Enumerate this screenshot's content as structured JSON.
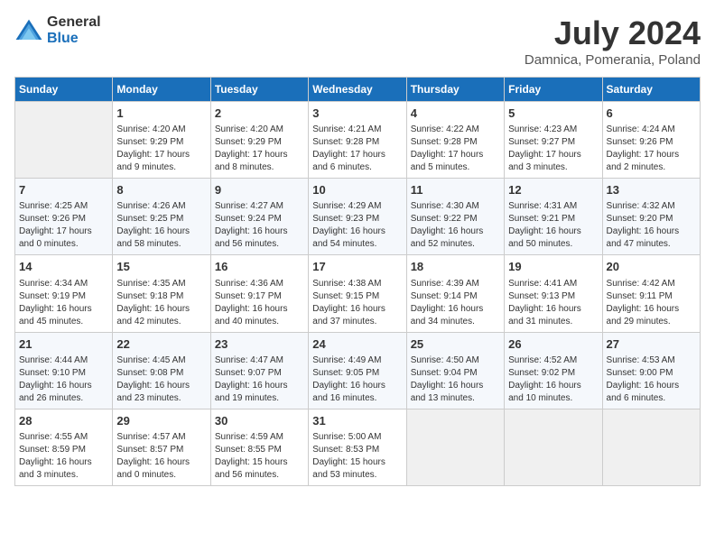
{
  "header": {
    "logo_line1": "General",
    "logo_line2": "Blue",
    "month_year": "July 2024",
    "location": "Damnica, Pomerania, Poland"
  },
  "weekdays": [
    "Sunday",
    "Monday",
    "Tuesday",
    "Wednesday",
    "Thursday",
    "Friday",
    "Saturday"
  ],
  "weeks": [
    [
      {
        "day": "",
        "info": ""
      },
      {
        "day": "1",
        "info": "Sunrise: 4:20 AM\nSunset: 9:29 PM\nDaylight: 17 hours\nand 9 minutes."
      },
      {
        "day": "2",
        "info": "Sunrise: 4:20 AM\nSunset: 9:29 PM\nDaylight: 17 hours\nand 8 minutes."
      },
      {
        "day": "3",
        "info": "Sunrise: 4:21 AM\nSunset: 9:28 PM\nDaylight: 17 hours\nand 6 minutes."
      },
      {
        "day": "4",
        "info": "Sunrise: 4:22 AM\nSunset: 9:28 PM\nDaylight: 17 hours\nand 5 minutes."
      },
      {
        "day": "5",
        "info": "Sunrise: 4:23 AM\nSunset: 9:27 PM\nDaylight: 17 hours\nand 3 minutes."
      },
      {
        "day": "6",
        "info": "Sunrise: 4:24 AM\nSunset: 9:26 PM\nDaylight: 17 hours\nand 2 minutes."
      }
    ],
    [
      {
        "day": "7",
        "info": "Sunrise: 4:25 AM\nSunset: 9:26 PM\nDaylight: 17 hours\nand 0 minutes."
      },
      {
        "day": "8",
        "info": "Sunrise: 4:26 AM\nSunset: 9:25 PM\nDaylight: 16 hours\nand 58 minutes."
      },
      {
        "day": "9",
        "info": "Sunrise: 4:27 AM\nSunset: 9:24 PM\nDaylight: 16 hours\nand 56 minutes."
      },
      {
        "day": "10",
        "info": "Sunrise: 4:29 AM\nSunset: 9:23 PM\nDaylight: 16 hours\nand 54 minutes."
      },
      {
        "day": "11",
        "info": "Sunrise: 4:30 AM\nSunset: 9:22 PM\nDaylight: 16 hours\nand 52 minutes."
      },
      {
        "day": "12",
        "info": "Sunrise: 4:31 AM\nSunset: 9:21 PM\nDaylight: 16 hours\nand 50 minutes."
      },
      {
        "day": "13",
        "info": "Sunrise: 4:32 AM\nSunset: 9:20 PM\nDaylight: 16 hours\nand 47 minutes."
      }
    ],
    [
      {
        "day": "14",
        "info": "Sunrise: 4:34 AM\nSunset: 9:19 PM\nDaylight: 16 hours\nand 45 minutes."
      },
      {
        "day": "15",
        "info": "Sunrise: 4:35 AM\nSunset: 9:18 PM\nDaylight: 16 hours\nand 42 minutes."
      },
      {
        "day": "16",
        "info": "Sunrise: 4:36 AM\nSunset: 9:17 PM\nDaylight: 16 hours\nand 40 minutes."
      },
      {
        "day": "17",
        "info": "Sunrise: 4:38 AM\nSunset: 9:15 PM\nDaylight: 16 hours\nand 37 minutes."
      },
      {
        "day": "18",
        "info": "Sunrise: 4:39 AM\nSunset: 9:14 PM\nDaylight: 16 hours\nand 34 minutes."
      },
      {
        "day": "19",
        "info": "Sunrise: 4:41 AM\nSunset: 9:13 PM\nDaylight: 16 hours\nand 31 minutes."
      },
      {
        "day": "20",
        "info": "Sunrise: 4:42 AM\nSunset: 9:11 PM\nDaylight: 16 hours\nand 29 minutes."
      }
    ],
    [
      {
        "day": "21",
        "info": "Sunrise: 4:44 AM\nSunset: 9:10 PM\nDaylight: 16 hours\nand 26 minutes."
      },
      {
        "day": "22",
        "info": "Sunrise: 4:45 AM\nSunset: 9:08 PM\nDaylight: 16 hours\nand 23 minutes."
      },
      {
        "day": "23",
        "info": "Sunrise: 4:47 AM\nSunset: 9:07 PM\nDaylight: 16 hours\nand 19 minutes."
      },
      {
        "day": "24",
        "info": "Sunrise: 4:49 AM\nSunset: 9:05 PM\nDaylight: 16 hours\nand 16 minutes."
      },
      {
        "day": "25",
        "info": "Sunrise: 4:50 AM\nSunset: 9:04 PM\nDaylight: 16 hours\nand 13 minutes."
      },
      {
        "day": "26",
        "info": "Sunrise: 4:52 AM\nSunset: 9:02 PM\nDaylight: 16 hours\nand 10 minutes."
      },
      {
        "day": "27",
        "info": "Sunrise: 4:53 AM\nSunset: 9:00 PM\nDaylight: 16 hours\nand 6 minutes."
      }
    ],
    [
      {
        "day": "28",
        "info": "Sunrise: 4:55 AM\nSunset: 8:59 PM\nDaylight: 16 hours\nand 3 minutes."
      },
      {
        "day": "29",
        "info": "Sunrise: 4:57 AM\nSunset: 8:57 PM\nDaylight: 16 hours\nand 0 minutes."
      },
      {
        "day": "30",
        "info": "Sunrise: 4:59 AM\nSunset: 8:55 PM\nDaylight: 15 hours\nand 56 minutes."
      },
      {
        "day": "31",
        "info": "Sunrise: 5:00 AM\nSunset: 8:53 PM\nDaylight: 15 hours\nand 53 minutes."
      },
      {
        "day": "",
        "info": ""
      },
      {
        "day": "",
        "info": ""
      },
      {
        "day": "",
        "info": ""
      }
    ]
  ]
}
